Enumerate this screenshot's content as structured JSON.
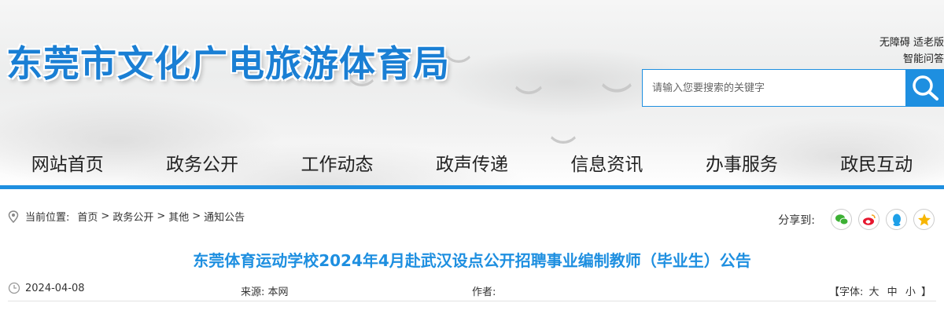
{
  "header": {
    "site_title": "东莞市文化广电旅游体育局",
    "top_links": [
      "无障碍",
      "适老版",
      "智能问答"
    ],
    "search_placeholder": "请输入您要搜索的关键字"
  },
  "nav": {
    "items": [
      "网站首页",
      "政务公开",
      "工作动态",
      "政声传递",
      "信息资讯",
      "办事服务",
      "政民互动"
    ]
  },
  "breadcrumb": {
    "label": "当前位置:",
    "items": [
      "首页",
      "政务公开",
      "其他",
      "通知公告"
    ],
    "separator": ">"
  },
  "share": {
    "label": "分享到:",
    "icons": [
      "wechat-icon",
      "weibo-icon",
      "qq-icon",
      "qzone-icon"
    ]
  },
  "article": {
    "title": "东莞体育运动学校2024年4月赴武汉设点公开招聘事业编制教师（毕业生）公告",
    "date": "2024-04-08",
    "source_label": "来源:",
    "source_value": "本网",
    "author_label": "作者:",
    "font_open": "【字体:",
    "font_large": "大",
    "font_medium": "中",
    "font_small": "小",
    "font_close": "】"
  },
  "colors": {
    "accent": "#1e8fe0",
    "title_blue": "#1a7fd4"
  }
}
